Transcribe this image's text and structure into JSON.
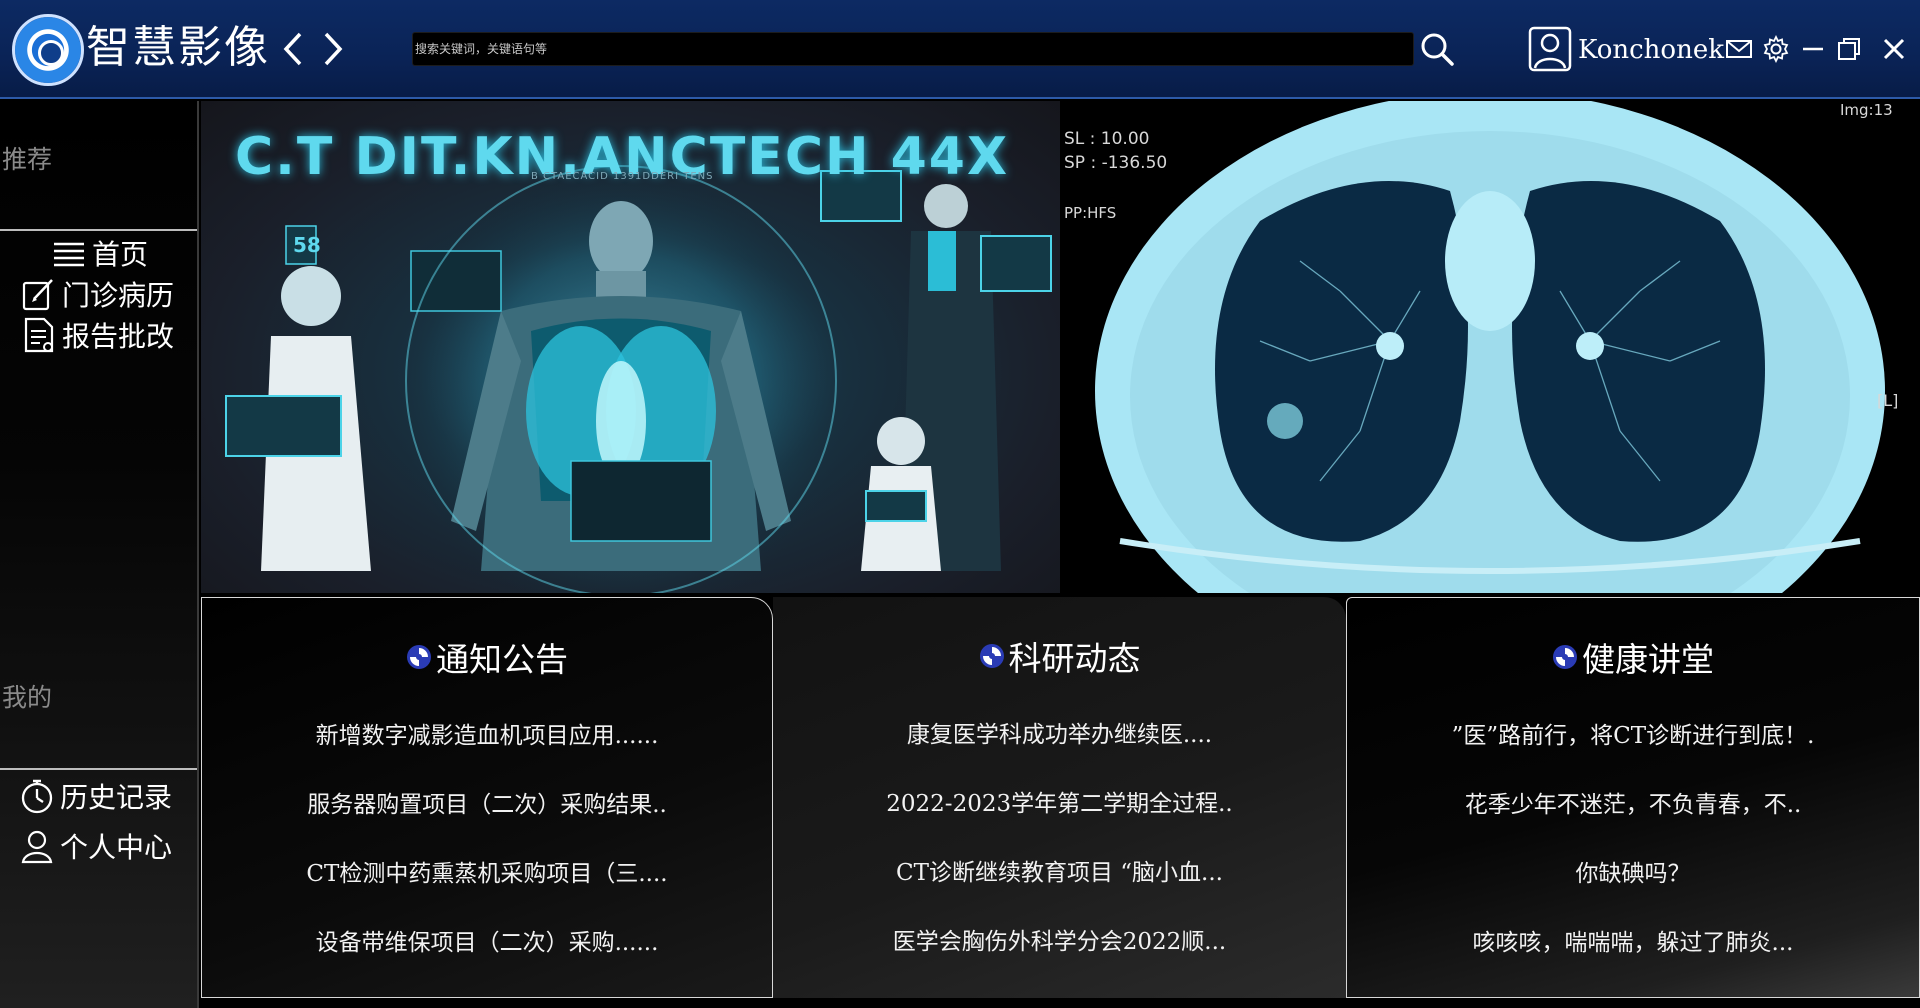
{
  "app": {
    "title": "智慧影像",
    "username": "Konchonek"
  },
  "search": {
    "placeholder": "搜索关键词，关键语句等"
  },
  "sidebar": {
    "recommend_title": "推荐",
    "recommend_items": [
      {
        "label": "首页",
        "icon": "list-icon"
      },
      {
        "label": "门诊病历",
        "icon": "edit-icon"
      },
      {
        "label": "报告批改",
        "icon": "report-icon"
      }
    ],
    "mine_title": "我的",
    "mine_items": [
      {
        "label": "历史记录",
        "icon": "stopwatch-icon"
      },
      {
        "label": "个人中心",
        "icon": "user-icon"
      }
    ]
  },
  "banner": {
    "left_title": "C.T  DIT.KN.ANCTECH  44X",
    "left_subtitle": "B CTAECACID 1391DDERI TENS",
    "left_badge": "58",
    "ct_overlay": {
      "sl": "SL : 10.00",
      "sp": "SP : -136.50",
      "pp": "PP:HFS",
      "img": "Img:13",
      "side": "[L]"
    }
  },
  "cards": [
    {
      "title": "通知公告",
      "items": [
        "新增数字减影造血机项目应用......",
        "服务器购置项目（二次）采购结果..",
        "CT检测中药熏蒸机采购项目（三....",
        "设备带维保项目（二次）采购......"
      ]
    },
    {
      "title": "科研动态",
      "items": [
        "康复医学科成功举办继续医....",
        "2022-2023学年第二学期全过程..",
        "CT诊断继续教育项目 “脑小血...",
        "医学会胸伤外科学分会2022顺..."
      ]
    },
    {
      "title": "健康讲堂",
      "items": [
        "”医”路前行，将CT诊断进行到底！.",
        "花季少年不迷茫，不负青春，不..",
        "你缺碘吗？",
        "咳咳咳，喘喘喘，躲过了肺炎..."
      ]
    }
  ],
  "colors": {
    "titlebar": "#0a2356",
    "accent_cyan": "#5fd9ee",
    "lung_tissue": "#a9e6f5"
  }
}
